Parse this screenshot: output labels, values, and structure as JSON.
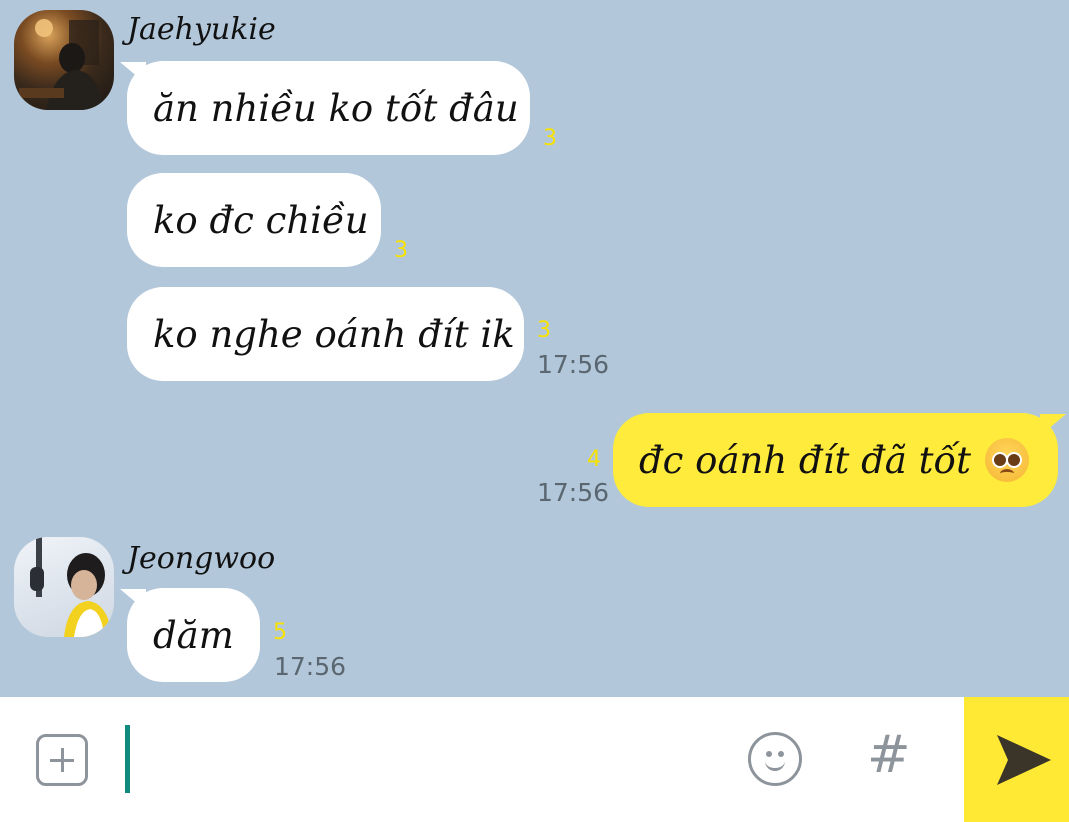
{
  "messages": [
    {
      "sender": "Jaehyukie",
      "text": "ăn nhiều ko tốt đâu",
      "count": "3",
      "time": ""
    },
    {
      "text": "ko đc chiều",
      "count": "3",
      "time": ""
    },
    {
      "text": "ko nghe oánh đít ik",
      "count": "3",
      "time": "17:56"
    },
    {
      "text": "đc oánh đít đã tốt",
      "count": "4",
      "time": "17:56",
      "emoji": "pleading-face-icon",
      "mine": true
    },
    {
      "sender": "Jeongwoo",
      "text": "dăm",
      "count": "5",
      "time": "17:56"
    }
  ],
  "input": {
    "placeholder": ""
  },
  "icons": {
    "attach": "plus-square-icon",
    "emoji": "smiley-icon",
    "hashtag": "#",
    "send": "send-arrow-icon"
  },
  "colors": {
    "chat_background": "#b2c7da",
    "incoming_bubble": "#ffffff",
    "outgoing_bubble": "#ffeb3b",
    "unread_count": "#f7e200",
    "send_button": "#ffe934"
  }
}
